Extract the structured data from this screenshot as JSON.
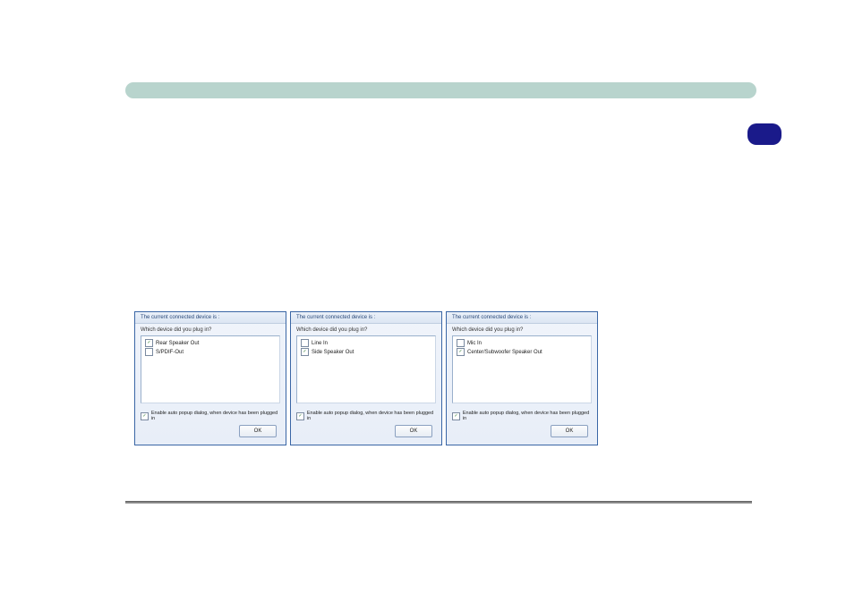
{
  "dialogs": [
    {
      "title": "The current connected device is :",
      "prompt": "Which device did you plug in?",
      "options": [
        {
          "label": "Rear Speaker Out",
          "checked": true
        },
        {
          "label": "S/PDIF-Out",
          "checked": false
        }
      ],
      "autoPopup": {
        "label": "Enable auto popup dialog, when device has been plugged in",
        "checked": true
      },
      "ok": "OK"
    },
    {
      "title": "The current connected device is :",
      "prompt": "Which device did you plug in?",
      "options": [
        {
          "label": "Line In",
          "checked": false
        },
        {
          "label": "Side Speaker Out",
          "checked": true
        }
      ],
      "autoPopup": {
        "label": "Enable auto popup dialog, when device has been plugged in",
        "checked": true
      },
      "ok": "OK"
    },
    {
      "title": "The current connected device is :",
      "prompt": "Which device did you plug in?",
      "options": [
        {
          "label": "Mic In",
          "checked": false
        },
        {
          "label": "Center/Subwoofer Speaker Out",
          "checked": true
        }
      ],
      "autoPopup": {
        "label": "Enable auto popup dialog, when device has been plugged in",
        "checked": true
      },
      "ok": "OK"
    }
  ]
}
